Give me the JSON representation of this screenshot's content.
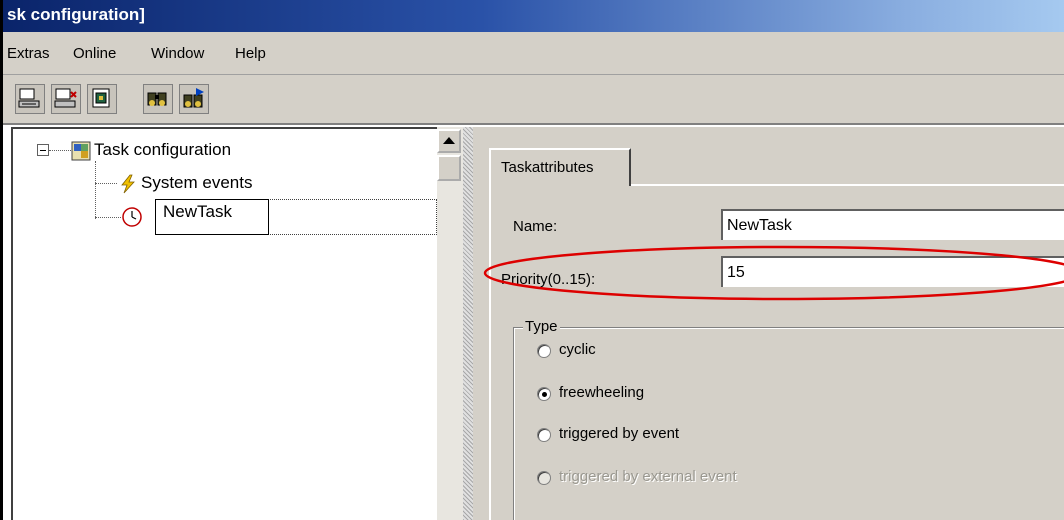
{
  "window": {
    "title": "sk configuration]"
  },
  "menu": {
    "items": [
      "Extras",
      "Online",
      "Window",
      "Help"
    ]
  },
  "toolbar": {
    "buttons": [
      "login-icon",
      "logout-icon",
      "build-icon",
      "search-icon",
      "search-next-icon"
    ]
  },
  "tree": {
    "root_label": "Task configuration",
    "children": [
      {
        "label": "System events",
        "icon": "lightning-icon"
      },
      {
        "label": "NewTask",
        "icon": "clock-icon",
        "selected": true
      }
    ]
  },
  "tabs": {
    "active_label": "Taskattributes"
  },
  "form": {
    "name_label": "Name:",
    "name_value": "NewTask",
    "priority_label": "Priority(0..15):",
    "priority_value": "15"
  },
  "type_group": {
    "legend": "Type",
    "options": [
      {
        "label": "cyclic",
        "checked": false,
        "enabled": true
      },
      {
        "label": "freewheeling",
        "checked": true,
        "enabled": true
      },
      {
        "label": "triggered by event",
        "checked": false,
        "enabled": true
      },
      {
        "label": "triggered by external event",
        "checked": false,
        "enabled": false
      }
    ]
  },
  "colors": {
    "title_start": "#0a246a",
    "title_end": "#a6caf0",
    "face": "#d4d0c8",
    "highlight_ring": "#dd0000"
  }
}
